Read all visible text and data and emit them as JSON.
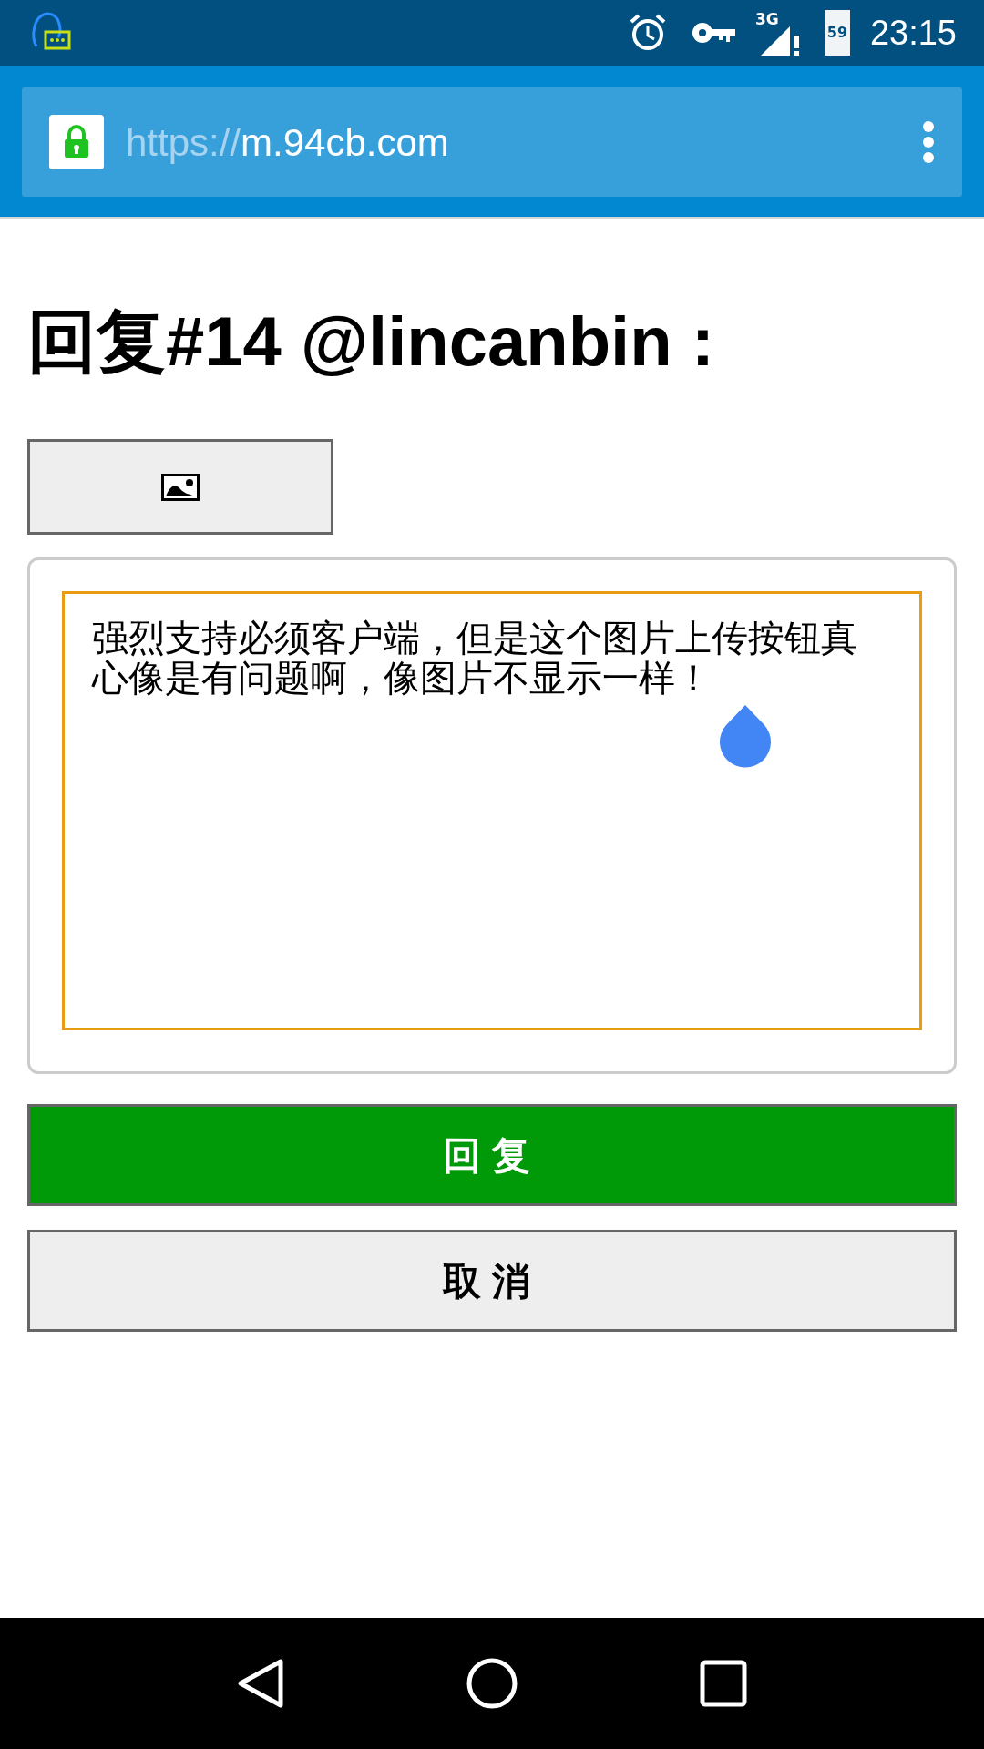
{
  "status_bar": {
    "time": "23:15",
    "network": "3G",
    "battery": "59"
  },
  "address_bar": {
    "scheme": "https://",
    "host": "m.94cb.com"
  },
  "heading": "回复#14 @lincanbin :",
  "reply_field": {
    "value": "强烈支持必须客户端，但是这个图片上传按钮真心像是有问题啊，像图片不显示一样！",
    "focused": true
  },
  "buttons": [
    {
      "label": "回复",
      "kind": "primary"
    },
    {
      "label": "取消",
      "kind": "secondary"
    }
  ]
}
